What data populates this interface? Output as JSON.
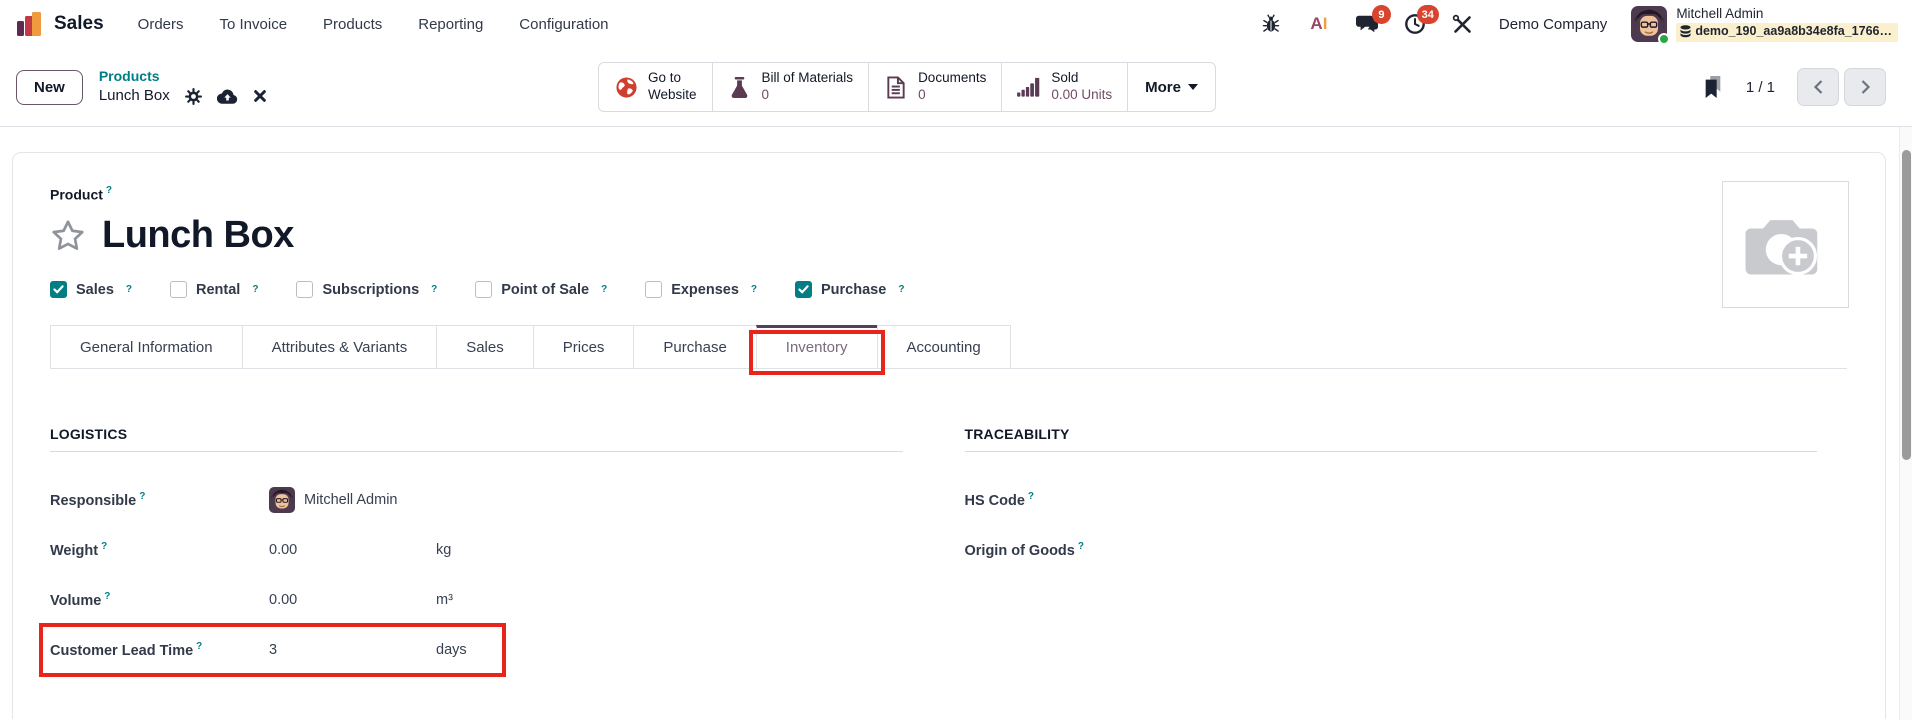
{
  "ui": {
    "help_mark": "?"
  },
  "colors": {
    "accent_teal": "#017e84",
    "accent_purple": "#714b67",
    "active_tab_border": "#514060",
    "annotation_red": "#e8251d",
    "badge_red": "#d9442f",
    "db_highlight_yellow": "#faf0cd",
    "online_green": "#28a745"
  },
  "navbar": {
    "app_name": "Sales",
    "menus": [
      "Orders",
      "To Invoice",
      "Products",
      "Reporting",
      "Configuration"
    ],
    "ai_a": "A",
    "ai_i": "I",
    "message_badge": "9",
    "activity_badge": "34",
    "company": "Demo Company",
    "user_name": "Mitchell Admin",
    "database": "demo_190_aa9a8b34e8fa_1766…"
  },
  "control_panel": {
    "new_button": "New",
    "breadcrumb": {
      "parent": "Products",
      "current": "Lunch Box"
    },
    "stat_buttons": [
      {
        "icon": "globe-icon",
        "line1": "Go to",
        "line2": "Website"
      },
      {
        "icon": "flask-icon",
        "line1": "Bill of Materials",
        "line2": "0"
      },
      {
        "icon": "document-icon",
        "line1": "Documents",
        "line2": "0"
      },
      {
        "icon": "bar-chart-icon",
        "line1": "Sold",
        "line2": "0.00 Units"
      }
    ],
    "more_button": "More",
    "pager": {
      "value": "1 / 1"
    }
  },
  "form": {
    "type_label": "Product",
    "title": "Lunch Box",
    "checkboxes": [
      {
        "label": "Sales",
        "checked": true
      },
      {
        "label": "Rental",
        "checked": false
      },
      {
        "label": "Subscriptions",
        "checked": false
      },
      {
        "label": "Point of Sale",
        "checked": false
      },
      {
        "label": "Expenses",
        "checked": false
      },
      {
        "label": "Purchase",
        "checked": true
      }
    ],
    "tabs": [
      "General Information",
      "Attributes & Variants",
      "Sales",
      "Prices",
      "Purchase",
      "Inventory",
      "Accounting"
    ],
    "active_tab": "Inventory",
    "logistics": {
      "title": "LOGISTICS",
      "responsible": {
        "label": "Responsible",
        "value": "Mitchell Admin"
      },
      "weight": {
        "label": "Weight",
        "value": "0.00",
        "unit": "kg"
      },
      "volume": {
        "label": "Volume",
        "value": "0.00",
        "unit": "m³"
      },
      "customer_lead_time": {
        "label": "Customer Lead Time",
        "value": "3",
        "unit": "days"
      }
    },
    "traceability": {
      "title": "TRACEABILITY",
      "hs_code": {
        "label": "HS Code",
        "value": ""
      },
      "origin": {
        "label": "Origin of Goods",
        "value": ""
      }
    }
  }
}
